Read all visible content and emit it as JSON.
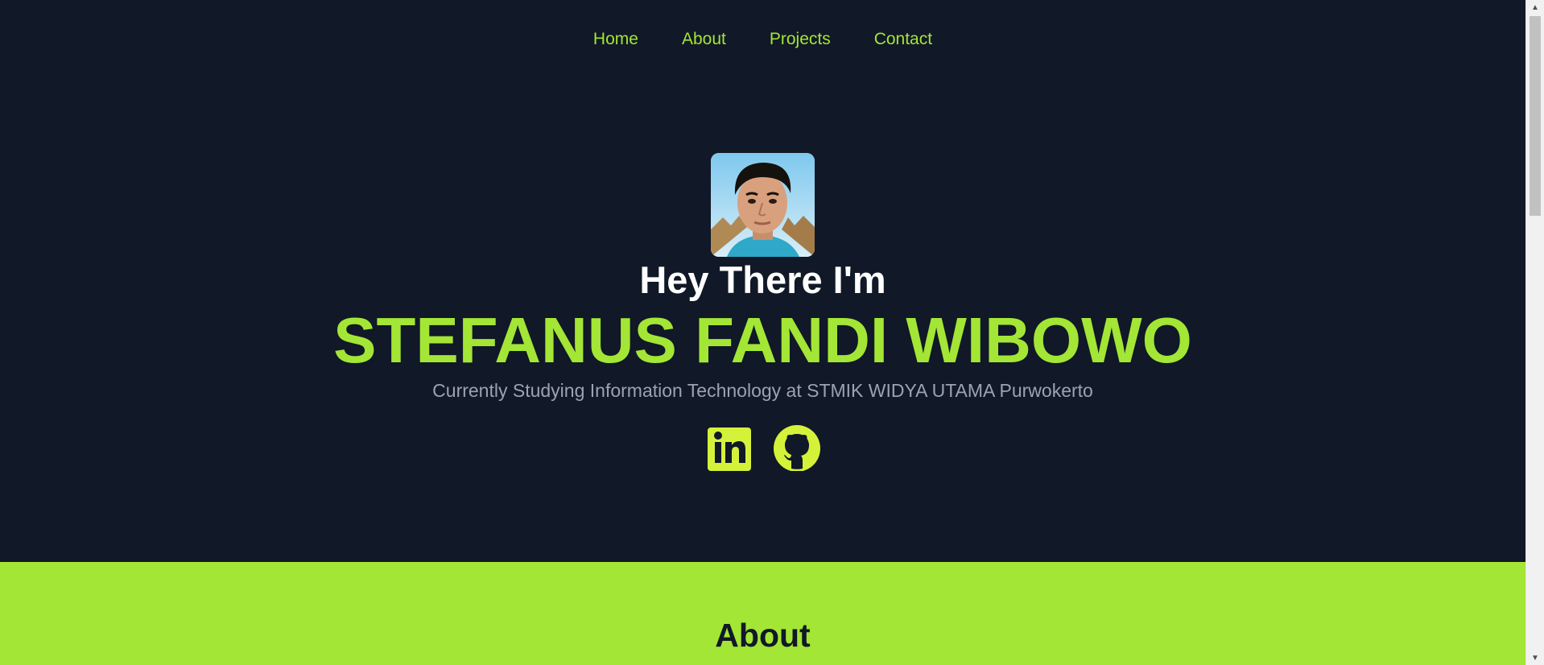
{
  "nav": {
    "items": [
      {
        "label": "Home"
      },
      {
        "label": "About"
      },
      {
        "label": "Projects"
      },
      {
        "label": "Contact"
      }
    ]
  },
  "hero": {
    "greeting": "Hey There I'm",
    "name": "STEFANUS FANDI WIBOWO",
    "subtitle": "Currently Studying Information Technology at STMIK WIDYA UTAMA Purwokerto",
    "socials": [
      {
        "icon": "linkedin-icon"
      },
      {
        "icon": "github-icon"
      }
    ]
  },
  "about": {
    "heading": "About"
  },
  "colors": {
    "background": "#111827",
    "accent": "#a3e635",
    "text": "#ffffff",
    "muted": "#9ca3af"
  },
  "scrollbar": {
    "up_icon": "arrow-up-icon",
    "down_icon": "arrow-down-icon"
  }
}
